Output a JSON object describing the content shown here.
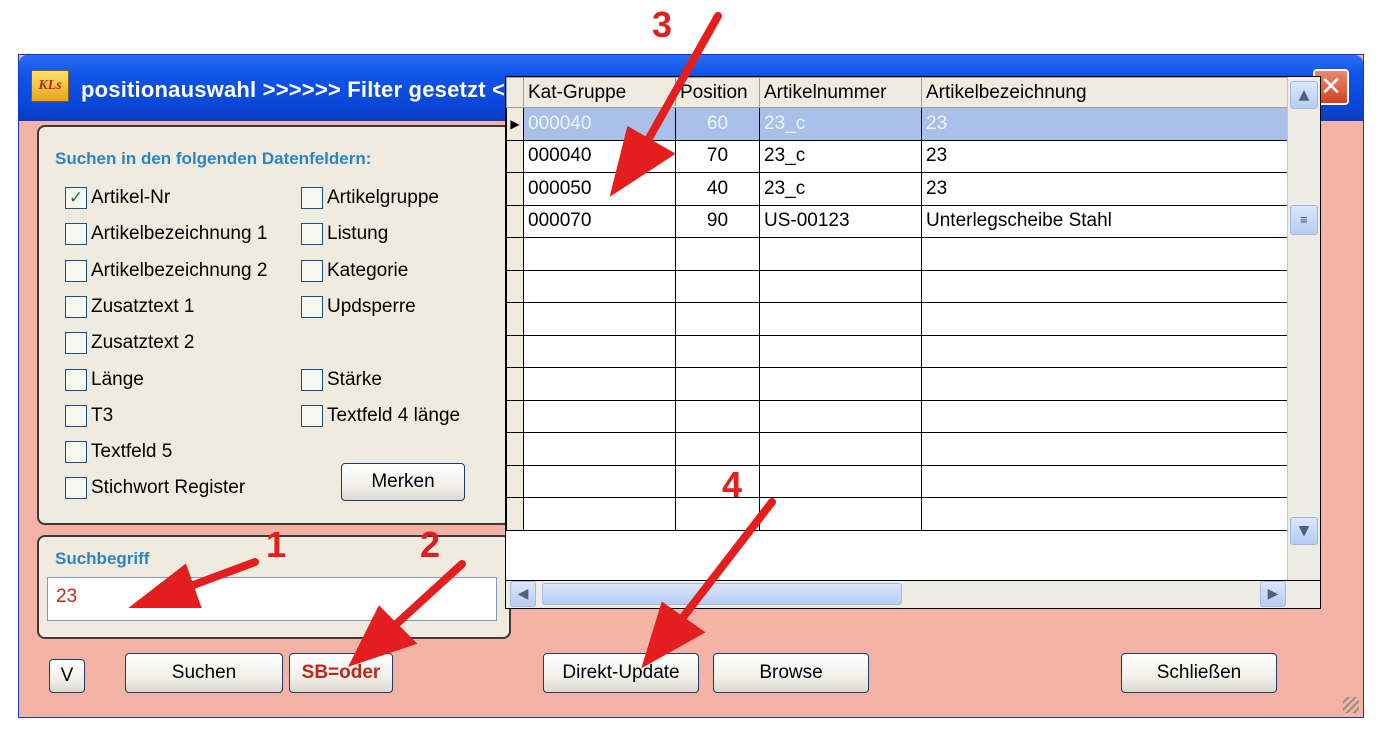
{
  "window": {
    "title": "positionauswahl  >>>>>>  Filter gesetzt  <<<<<<",
    "app_icon_label": "KLs",
    "close_glyph": "✕"
  },
  "search_fields": {
    "title": "Suchen in den folgenden Datenfeldern:",
    "left_column": [
      {
        "label": "Artikel-Nr",
        "checked": true
      },
      {
        "label": "Artikelbezeichnung 1",
        "checked": false
      },
      {
        "label": "Artikelbezeichnung 2",
        "checked": false
      },
      {
        "label": "Zusatztext 1",
        "checked": false
      },
      {
        "label": "Zusatztext 2",
        "checked": false
      },
      {
        "label": "Länge",
        "checked": false
      },
      {
        "label": "T3",
        "checked": false
      },
      {
        "label": "Textfeld 5",
        "checked": false
      },
      {
        "label": "Stichwort Register",
        "checked": false
      }
    ],
    "right_column": [
      {
        "label": "Artikelgruppe",
        "checked": false
      },
      {
        "label": "Listung",
        "checked": false
      },
      {
        "label": "Kategorie",
        "checked": false
      },
      {
        "label": "Updsperre",
        "checked": false
      },
      {
        "label": "Stärke",
        "checked": false
      },
      {
        "label": "Textfeld 4 länge",
        "checked": false
      }
    ],
    "merken_button": "Merken"
  },
  "search_term": {
    "title": "Suchbegriff",
    "value": "23"
  },
  "buttons": {
    "v": "V",
    "suchen": "Suchen",
    "sb_oder": "SB=oder",
    "direkt_update": "Direkt-Update",
    "browse": "Browse",
    "schliessen": "Schließen"
  },
  "grid": {
    "columns": [
      "Kat-Gruppe",
      "Position",
      "Artikelnummer",
      "Artikelbezeichnung"
    ],
    "rows": [
      [
        "000040",
        "60",
        "23_c",
        "23"
      ],
      [
        "000040",
        "70",
        "23_c",
        "23"
      ],
      [
        "000050",
        "40",
        "23_c",
        "23"
      ],
      [
        "000070",
        "90",
        "US-00123",
        "Unterlegscheibe Stahl"
      ]
    ],
    "selected_row": 0,
    "selected_marker": "▶",
    "empty_rows": 9
  },
  "annotations": {
    "numbers": [
      "1",
      "2",
      "3",
      "4"
    ],
    "color": "#e41e1e"
  }
}
